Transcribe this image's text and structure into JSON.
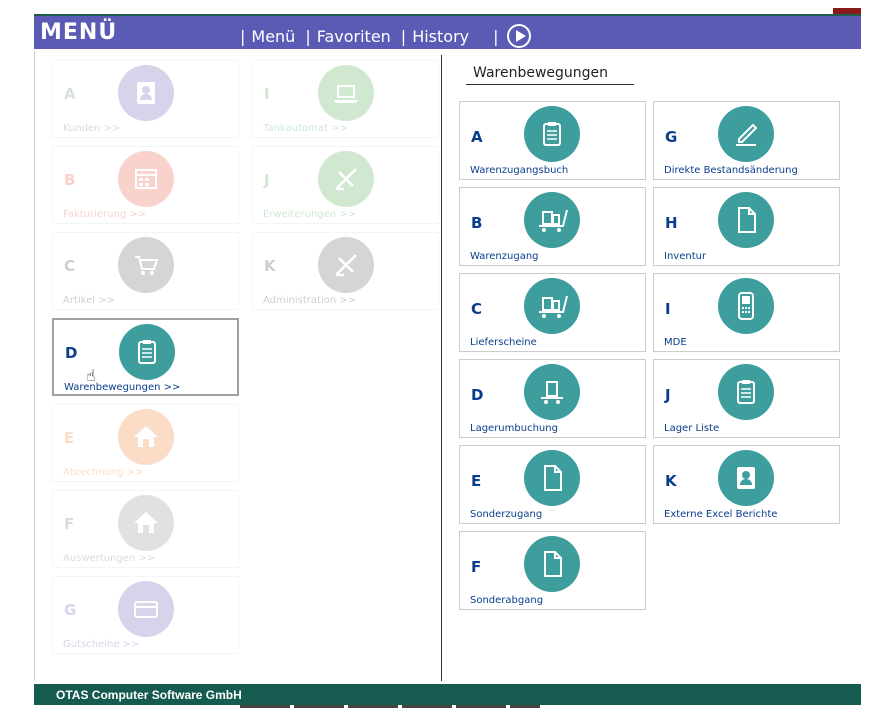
{
  "header": {
    "brand": "MENÜ",
    "nav": [
      {
        "label": "Menü"
      },
      {
        "label": "Favoriten"
      },
      {
        "label": "History"
      }
    ],
    "play_icon": "play-circle-icon",
    "color": "#5b5ab5"
  },
  "left_menu": [
    {
      "letter": "A",
      "label": "Kunden >>",
      "icon": "contacts-icon",
      "color": "#8b84c8"
    },
    {
      "letter": "B",
      "label": "Fakturierung >>",
      "icon": "calculator-icon",
      "color": "#f08070"
    },
    {
      "letter": "C",
      "label": "Artikel >>",
      "icon": "cart-icon",
      "color": "#888888"
    },
    {
      "letter": "D",
      "label": "Warenbewegungen >>",
      "icon": "clipboard-icon",
      "color": "#3d9e9d",
      "active": true
    },
    {
      "letter": "E",
      "label": "Abrechnung >>",
      "icon": "house-icon",
      "color": "#f5a060"
    },
    {
      "letter": "F",
      "label": "Auswertungen >>",
      "icon": "house-icon",
      "color": "#aaaaaa"
    },
    {
      "letter": "G",
      "label": "Gutscheine >>",
      "icon": "card-icon",
      "color": "#8b84c8"
    },
    {
      "letter": "I",
      "label": "Tankautomat >>",
      "icon": "laptop-icon",
      "color": "#7cc07c"
    },
    {
      "letter": "J",
      "label": "Erweiterungen >>",
      "icon": "tools-icon",
      "color": "#7cc07c"
    },
    {
      "letter": "K",
      "label": "Administration >>",
      "icon": "tools-icon",
      "color": "#888888"
    }
  ],
  "section": {
    "title": "Warenbewegungen"
  },
  "right_menu": [
    {
      "letter": "A",
      "label": "Warenzugangsbuch",
      "icon": "clipboard-icon"
    },
    {
      "letter": "B",
      "label": "Warenzugang",
      "icon": "luggage-cart-icon"
    },
    {
      "letter": "C",
      "label": "Lieferscheine",
      "icon": "luggage-cart-icon"
    },
    {
      "letter": "D",
      "label": "Lagerumbuchung",
      "icon": "trolley-icon"
    },
    {
      "letter": "E",
      "label": "Sonderzugang",
      "icon": "document-icon"
    },
    {
      "letter": "F",
      "label": "Sonderabgang",
      "icon": "document-icon"
    },
    {
      "letter": "G",
      "label": "Direkte Bestandsänderung",
      "icon": "pen-icon"
    },
    {
      "letter": "H",
      "label": "Inventur",
      "icon": "document-icon"
    },
    {
      "letter": "I",
      "label": "MDE",
      "icon": "handheld-icon"
    },
    {
      "letter": "J",
      "label": "Lager Liste",
      "icon": "clipboard-icon"
    },
    {
      "letter": "K",
      "label": "Externe Excel Berichte",
      "icon": "contacts-icon"
    }
  ],
  "footer": {
    "text": "OTAS Computer Software GmbH"
  }
}
